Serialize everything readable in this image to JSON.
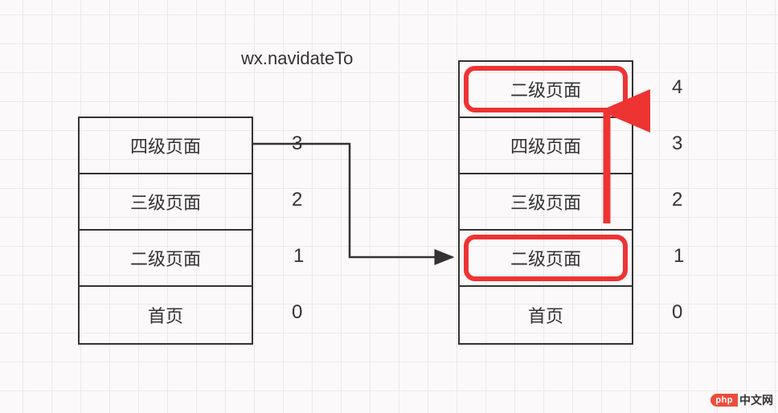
{
  "title": "wx.navidateTo",
  "left_stack": {
    "cells": [
      {
        "label": "四级页面",
        "index": "3",
        "highlight": false
      },
      {
        "label": "三级页面",
        "index": "2",
        "highlight": false
      },
      {
        "label": "二级页面",
        "index": "1",
        "highlight": false
      },
      {
        "label": "首页",
        "index": "0",
        "highlight": false
      }
    ]
  },
  "right_stack": {
    "cells": [
      {
        "label": "二级页面",
        "index": "4",
        "highlight": true
      },
      {
        "label": "四级页面",
        "index": "3",
        "highlight": false
      },
      {
        "label": "三级页面",
        "index": "2",
        "highlight": false
      },
      {
        "label": "二级页面",
        "index": "1",
        "highlight": true
      },
      {
        "label": "首页",
        "index": "0",
        "highlight": false
      }
    ]
  },
  "watermark": {
    "badge": "php",
    "text": "中文网"
  },
  "chart_data": {
    "type": "diagram",
    "title": "wx.navidateTo",
    "description": "Page stack diagram showing wx.navigateTo behavior: navigating from an existing page (二级页面 at index 1) pushes a new instance of that page (二级页面) onto the top of the stack at index 4.",
    "left_stack": [
      {
        "index": 3,
        "page": "四级页面"
      },
      {
        "index": 2,
        "page": "三级页面"
      },
      {
        "index": 1,
        "page": "二级页面"
      },
      {
        "index": 0,
        "page": "首页"
      }
    ],
    "right_stack": [
      {
        "index": 4,
        "page": "二级页面",
        "highlighted": true
      },
      {
        "index": 3,
        "page": "四级页面"
      },
      {
        "index": 2,
        "page": "三级页面"
      },
      {
        "index": 1,
        "page": "二级页面",
        "highlighted": true
      },
      {
        "index": 0,
        "page": "首页"
      }
    ],
    "arrows": [
      {
        "from": "left_stack top (四级页面, index 3)",
        "to": "right_stack 二级页面 (index 1)",
        "style": "black right-angle"
      },
      {
        "from": "right_stack 二级页面 (index 1)",
        "to": "right_stack 二级页面 (index 4)",
        "style": "red upward"
      }
    ]
  }
}
